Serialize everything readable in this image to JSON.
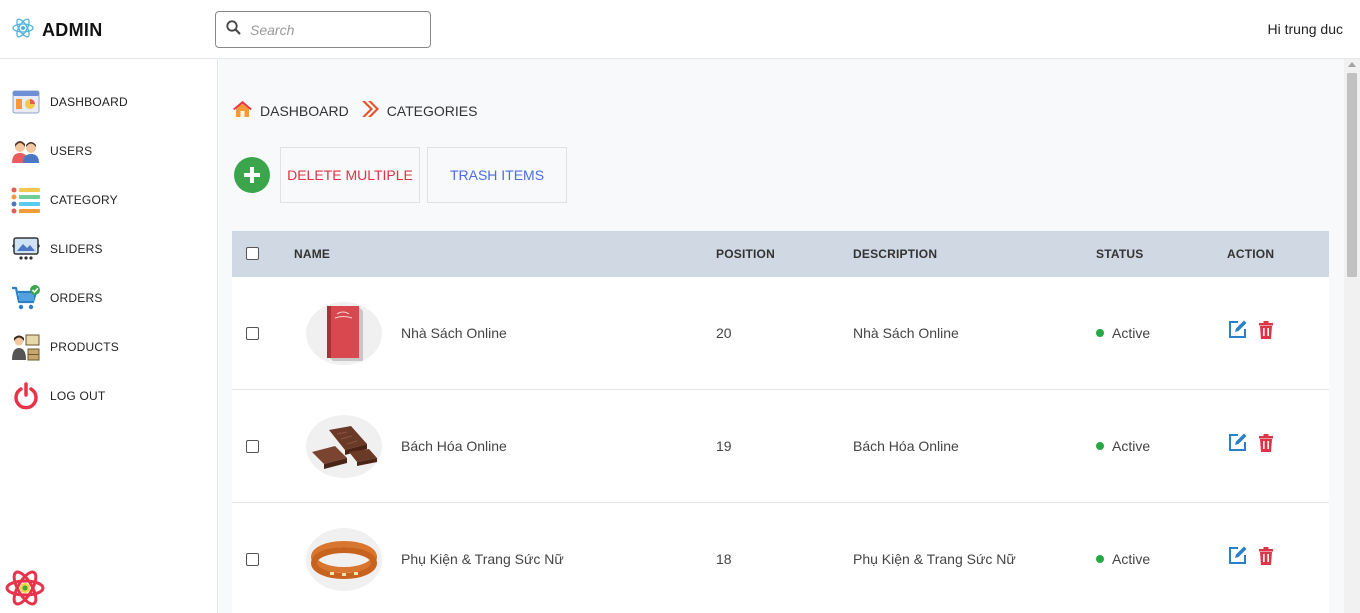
{
  "header": {
    "brand": "ADMIN",
    "search_placeholder": "Search",
    "search_value": "",
    "greeting": "Hi trung duc"
  },
  "sidebar": {
    "items": [
      {
        "label": "DASHBOARD",
        "icon": "dashboard-icon"
      },
      {
        "label": "USERS",
        "icon": "users-icon"
      },
      {
        "label": "CATEGORY",
        "icon": "category-icon"
      },
      {
        "label": "SLIDERS",
        "icon": "sliders-icon"
      },
      {
        "label": "ORDERS",
        "icon": "orders-icon"
      },
      {
        "label": "PRODUCTS",
        "icon": "products-icon"
      },
      {
        "label": "LOG OUT",
        "icon": "logout-icon"
      }
    ]
  },
  "breadcrumb": {
    "items": [
      "DASHBOARD",
      "CATEGORIES"
    ]
  },
  "toolbar": {
    "delete_label": "DELETE MULTIPLE",
    "trash_label": "TRASH ITEMS"
  },
  "table": {
    "headers": {
      "name": "NAME",
      "position": "POSITION",
      "description": "DESCRIPTION",
      "status": "STATUS",
      "action": "ACTION"
    },
    "rows": [
      {
        "name": "Nhà Sách Online",
        "position": "20",
        "description": "Nhà Sách Online",
        "status": "Active",
        "image": "book"
      },
      {
        "name": "Bách Hóa Online",
        "position": "19",
        "description": "Bách Hóa Online",
        "status": "Active",
        "image": "chocolate"
      },
      {
        "name": "Phụ Kiện & Trang Sức Nữ",
        "position": "18",
        "description": "Phụ Kiện & Trang Sức Nữ",
        "status": "Active",
        "image": "bracelet"
      }
    ]
  },
  "colors": {
    "accent_green": "#3aa54a",
    "delete_red": "#dc3545",
    "trash_blue": "#4a6ee0",
    "table_header": "#cfd8e3",
    "status_active": "#28a745",
    "edit_blue": "#2a7fc9"
  }
}
